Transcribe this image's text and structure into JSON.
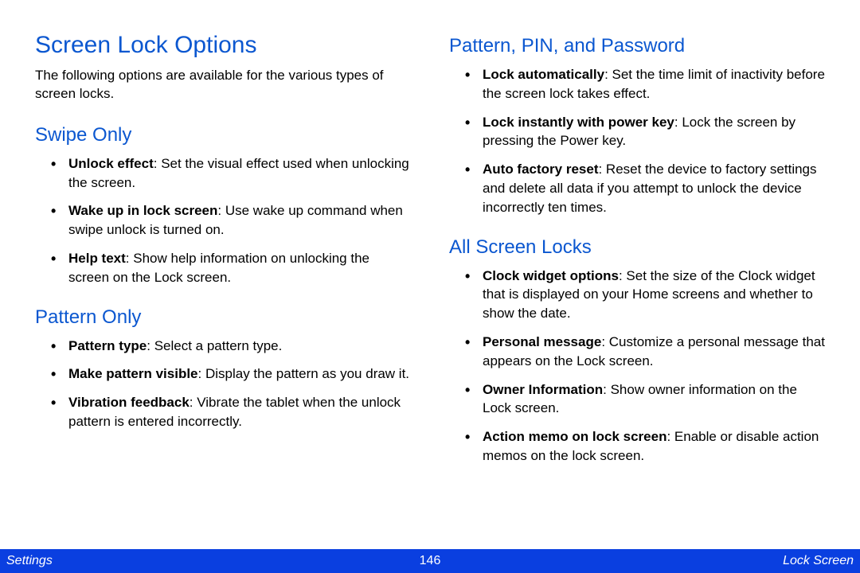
{
  "title": "Screen Lock Options",
  "intro": "The following options are available for the various types of screen locks.",
  "left_sections": [
    {
      "heading": "Swipe Only",
      "items": [
        {
          "term": "Unlock effect",
          "desc": ": Set the visual effect used when unlocking the screen."
        },
        {
          "term": "Wake up in lock screen",
          "desc": ": Use wake up command when swipe unlock is turned on."
        },
        {
          "term": "Help text",
          "desc": ": Show help information on unlocking the screen on the Lock screen."
        }
      ]
    },
    {
      "heading": "Pattern Only",
      "items": [
        {
          "term": "Pattern type",
          "desc": ": Select a pattern type."
        },
        {
          "term": "Make pattern visible",
          "desc": ": Display the pattern as you draw it."
        },
        {
          "term": "Vibration feedback",
          "desc": ": Vibrate the tablet when the unlock pattern is entered incorrectly."
        }
      ]
    }
  ],
  "right_sections": [
    {
      "heading": "Pattern, PIN, and Password",
      "items": [
        {
          "term": "Lock automatically",
          "desc": ": Set the time limit of inactivity before the screen lock takes effect."
        },
        {
          "term": "Lock instantly with power key",
          "desc": ": Lock the screen by pressing the Power key."
        },
        {
          "term": "Auto factory reset",
          "desc": ": Reset the device to factory settings and delete all data if you attempt to unlock the device incorrectly ten times."
        }
      ]
    },
    {
      "heading": "All Screen Locks",
      "items": [
        {
          "term": "Clock widget options",
          "desc": ": Set the size of the Clock widget that is displayed on your Home screens and whether to show the date."
        },
        {
          "term": "Personal message",
          "desc": ": Customize a personal message that appears on the Lock screen."
        },
        {
          "term": "Owner Information",
          "desc": ": Show owner information on the Lock screen."
        },
        {
          "term": "Action memo on lock screen",
          "desc": ": Enable or disable action memos on the lock screen."
        }
      ]
    }
  ],
  "footer": {
    "left": "Settings",
    "center": "146",
    "right": "Lock Screen"
  }
}
